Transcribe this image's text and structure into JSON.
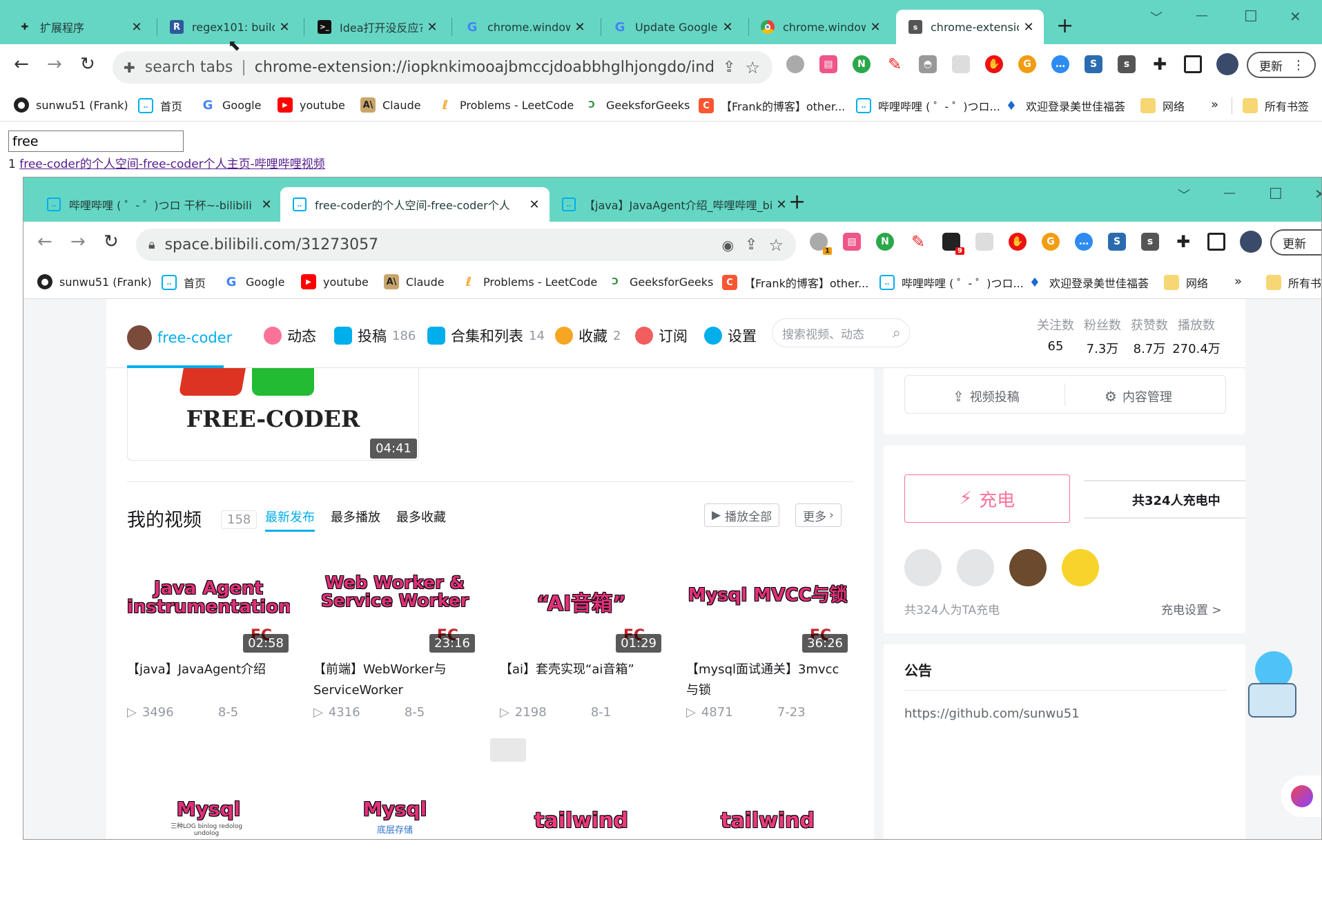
{
  "browser": {
    "tabs": [
      {
        "title": "扩展程序",
        "icon": "puzzle-icon"
      },
      {
        "title": "regex101: build,",
        "icon": "regex101-icon"
      },
      {
        "title": "Idea打开没反应?",
        "icon": "terminal-icon"
      },
      {
        "title": "chrome.window",
        "icon": "google-icon"
      },
      {
        "title": "Update Google",
        "icon": "google-icon"
      },
      {
        "title": "chrome.window",
        "icon": "chrome-icon"
      },
      {
        "title": "chrome-extensio",
        "icon": "extension-s-icon"
      }
    ],
    "omnibox_prefix": "search tabs",
    "url": "chrome-extension://iopknkimooajbmccjdoabbhglhjongdo/inde...",
    "update_label": "更新",
    "bookmarks": [
      "sunwu51 (Frank)",
      "首页",
      "Google",
      "youtube",
      "Claude",
      "Problems - LeetCode",
      "GeeksforGeeks",
      "【Frank的博客】other...",
      "哔哩哔哩 ( ゜- ゜)つロ...",
      "欢迎登录美世佳福荟",
      "网络"
    ],
    "all_bookmarks": "所有书签",
    "more_bookmarks": "»"
  },
  "popup": {
    "search_value": "free",
    "result_index": "1",
    "result_link": "free-coder的个人空间-free-coder个人主页-哔哩哔哩视频"
  },
  "window2": {
    "tabs": [
      {
        "title": "哔哩哔哩 ( ゜- ゜)つロ 干杯~-bilibili"
      },
      {
        "title": "free-coder的个人空间-free-coder个人"
      },
      {
        "title": "【java】JavaAgent介绍_哔哩哔哩_bili"
      }
    ],
    "url": "space.bilibili.com/31273057",
    "update_label": "更新",
    "ext_badge_1": "1",
    "ext_badge_9": "9",
    "bookmarks": [
      "sunwu51 (Frank)",
      "首页",
      "Google",
      "youtube",
      "Claude",
      "Problems - LeetCode",
      "GeeksforGeeks",
      "【Frank的博客】other...",
      "哔哩哔哩 ( ゜- ゜)つロ...",
      "欢迎登录美世佳福荟",
      "网络"
    ],
    "all_bookmarks": "所有书",
    "more_bookmarks": "»"
  },
  "space": {
    "username": "free-coder",
    "nav": [
      {
        "label": "动态",
        "count": ""
      },
      {
        "label": "投稿",
        "count": "186"
      },
      {
        "label": "合集和列表",
        "count": "14"
      },
      {
        "label": "收藏",
        "count": "2"
      },
      {
        "label": "订阅",
        "count": ""
      },
      {
        "label": "设置",
        "count": ""
      }
    ],
    "search_placeholder": "搜索视频、动态",
    "stats": [
      {
        "label": "关注数",
        "value": "65"
      },
      {
        "label": "粉丝数",
        "value": "7.3万"
      },
      {
        "label": "获赞数",
        "value": "8.7万"
      },
      {
        "label": "播放数",
        "value": "270.4万"
      }
    ],
    "banner_text": "FREE-CODER",
    "banner_duration": "04:41",
    "my_videos_title": "我的视频",
    "my_videos_count": "158",
    "sort_tabs": [
      "最新发布",
      "最多播放",
      "最多收藏"
    ],
    "play_all": "播放全部",
    "more": "更多",
    "videos": [
      {
        "art": "Java Agent instrumentation",
        "duration": "02:58",
        "title": "【java】JavaAgent介绍",
        "plays": "3496",
        "date": "8-5"
      },
      {
        "art": "Web Worker & Service Worker",
        "duration": "23:16",
        "title": "【前端】WebWorker与ServiceWorker",
        "plays": "4316",
        "date": "8-5"
      },
      {
        "art": "“AI音箱”",
        "duration": "01:29",
        "title": "【ai】套壳实现“ai音箱”",
        "plays": "2198",
        "date": "8-1"
      },
      {
        "art": "Mysql MVCC与锁",
        "duration": "36:26",
        "title": "【mysql面试通关】3mvcc与锁",
        "plays": "4871",
        "date": "7-23"
      }
    ],
    "videos_row2": [
      {
        "art": "Mysql",
        "sub": "三种LOG binlog redolog undolog"
      },
      {
        "art": "Mysql",
        "sub": "底层存储"
      },
      {
        "art": "tailwind",
        "sub": ""
      },
      {
        "art": "tailwind",
        "sub": ""
      }
    ],
    "upload_video": "视频投稿",
    "content_manage": "内容管理",
    "charge_button": "充电",
    "charge_count_title": "共324人充电中",
    "charge_footer": "共324人为TA充电",
    "charge_settings": "充电设置 >",
    "notice_title": "公告",
    "notice_text": "https://github.com/sunwu51"
  },
  "colors": {
    "tab_bar": "#66d6c4",
    "bili_blue": "#00aeec",
    "bili_pink": "#fb7299"
  }
}
